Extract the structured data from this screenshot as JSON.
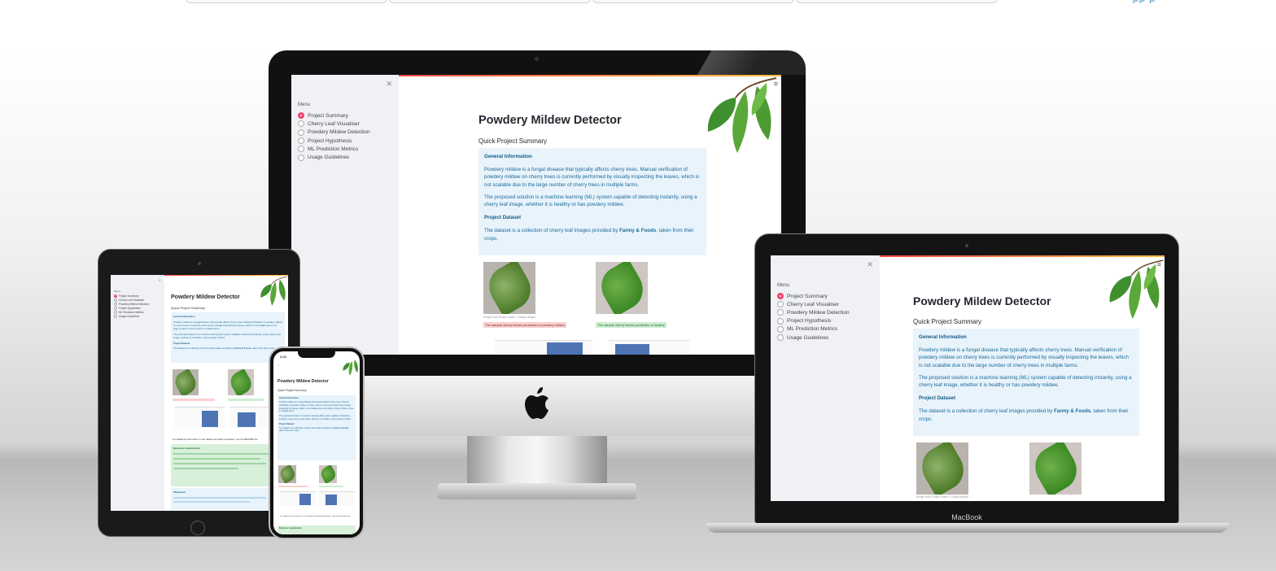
{
  "app": {
    "menu_title": "Menu",
    "menu_items": [
      {
        "label": "Project Summary",
        "selected": true
      },
      {
        "label": "Cherry Leaf Visualiser",
        "selected": false
      },
      {
        "label": "Powdery Mildew Detection",
        "selected": false
      },
      {
        "label": "Project Hypothesis",
        "selected": false
      },
      {
        "label": "ML Prediction Metrics",
        "selected": false
      },
      {
        "label": "Usage Guidelines",
        "selected": false
      }
    ],
    "title": "Powdery Mildew Detector",
    "subtitle": "Quick Project Summary",
    "general_info_label": "General Information",
    "general_info_p1": "Powdery mildew is a fungal disease that typically affects cherry trees. Manual verification of powdery mildew on cherry trees is currently performed by visually inspecting the leaves, which is not scalable due to the large number of cherry trees in multiple farms.",
    "general_info_p2": "The proposed solution is a machine learning (ML) system capable of detecting instantly, using a cherry leaf image, whether it is healthy or has powdery mildew.",
    "dataset_label": "Project Dataset",
    "dataset_text_pre": "The dataset is a collection of cherry leaf images provided by ",
    "dataset_text_bold": "Farmy & Foods",
    "dataset_text_post": ", taken from their crops.",
    "image_caption_1": "Image from Gdaps online / Gdaps delight",
    "image_caption_2": "Image from Gdaps online / Gdaps delight",
    "prediction_mildew": "The sample cherry leaves prediction is powdery mildew",
    "prediction_healthy": "The sample cherry leaves prediction of healthy",
    "business_requirements_label": "Business requirements",
    "objectives_label": "Objectives",
    "dataset_link_text": "For additional information on the dataset and data preparation, see the README file"
  },
  "devices": {
    "laptop_brand": "MacBook",
    "phone_time": "2:41"
  },
  "colors": {
    "accent": "#ef476f",
    "sidebar": "#eff1f5",
    "info_bg": "#e8f3fb",
    "info_text": "#1c6a99",
    "bar": "#4f74b4"
  }
}
